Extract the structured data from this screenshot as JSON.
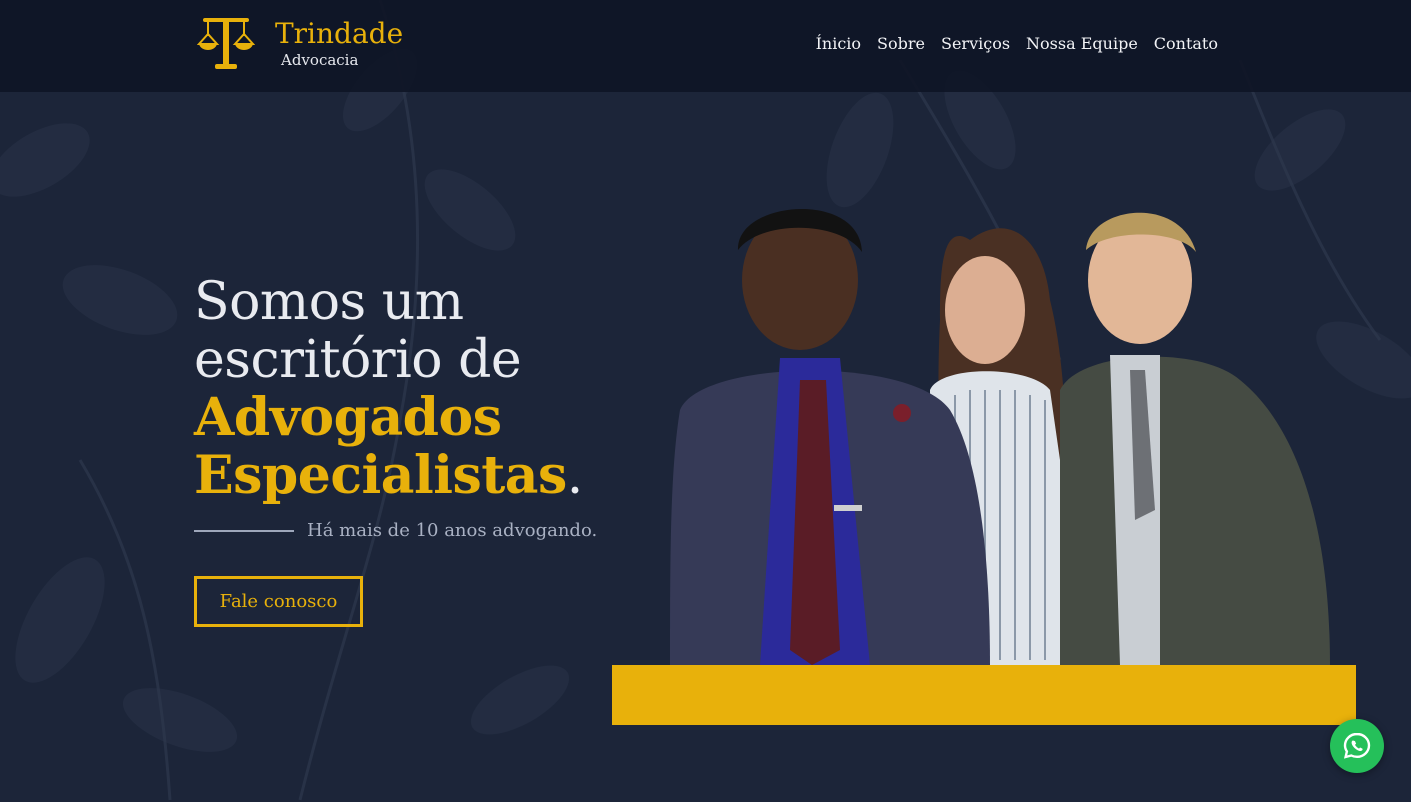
{
  "brand": {
    "name": "Trindade",
    "tagline": "Advocacia"
  },
  "nav": {
    "items": [
      "Ínicio",
      "Sobre",
      "Serviços",
      "Nossa Equipe",
      "Contato"
    ]
  },
  "hero": {
    "line1": "Somos um",
    "line2": "escritório de",
    "accent1": "Advogados",
    "accent2": "Especialistas",
    "period": ".",
    "subtitle": "Há mais de 10 anos advogando.",
    "cta_label": "Fale conosco"
  },
  "colors": {
    "background": "#1c2539",
    "navbar": "#0e1424",
    "accent": "#e8b10b",
    "whatsapp": "#25c05a"
  },
  "icons": {
    "logo": "scales-of-justice-icon",
    "chat": "whatsapp-icon"
  }
}
